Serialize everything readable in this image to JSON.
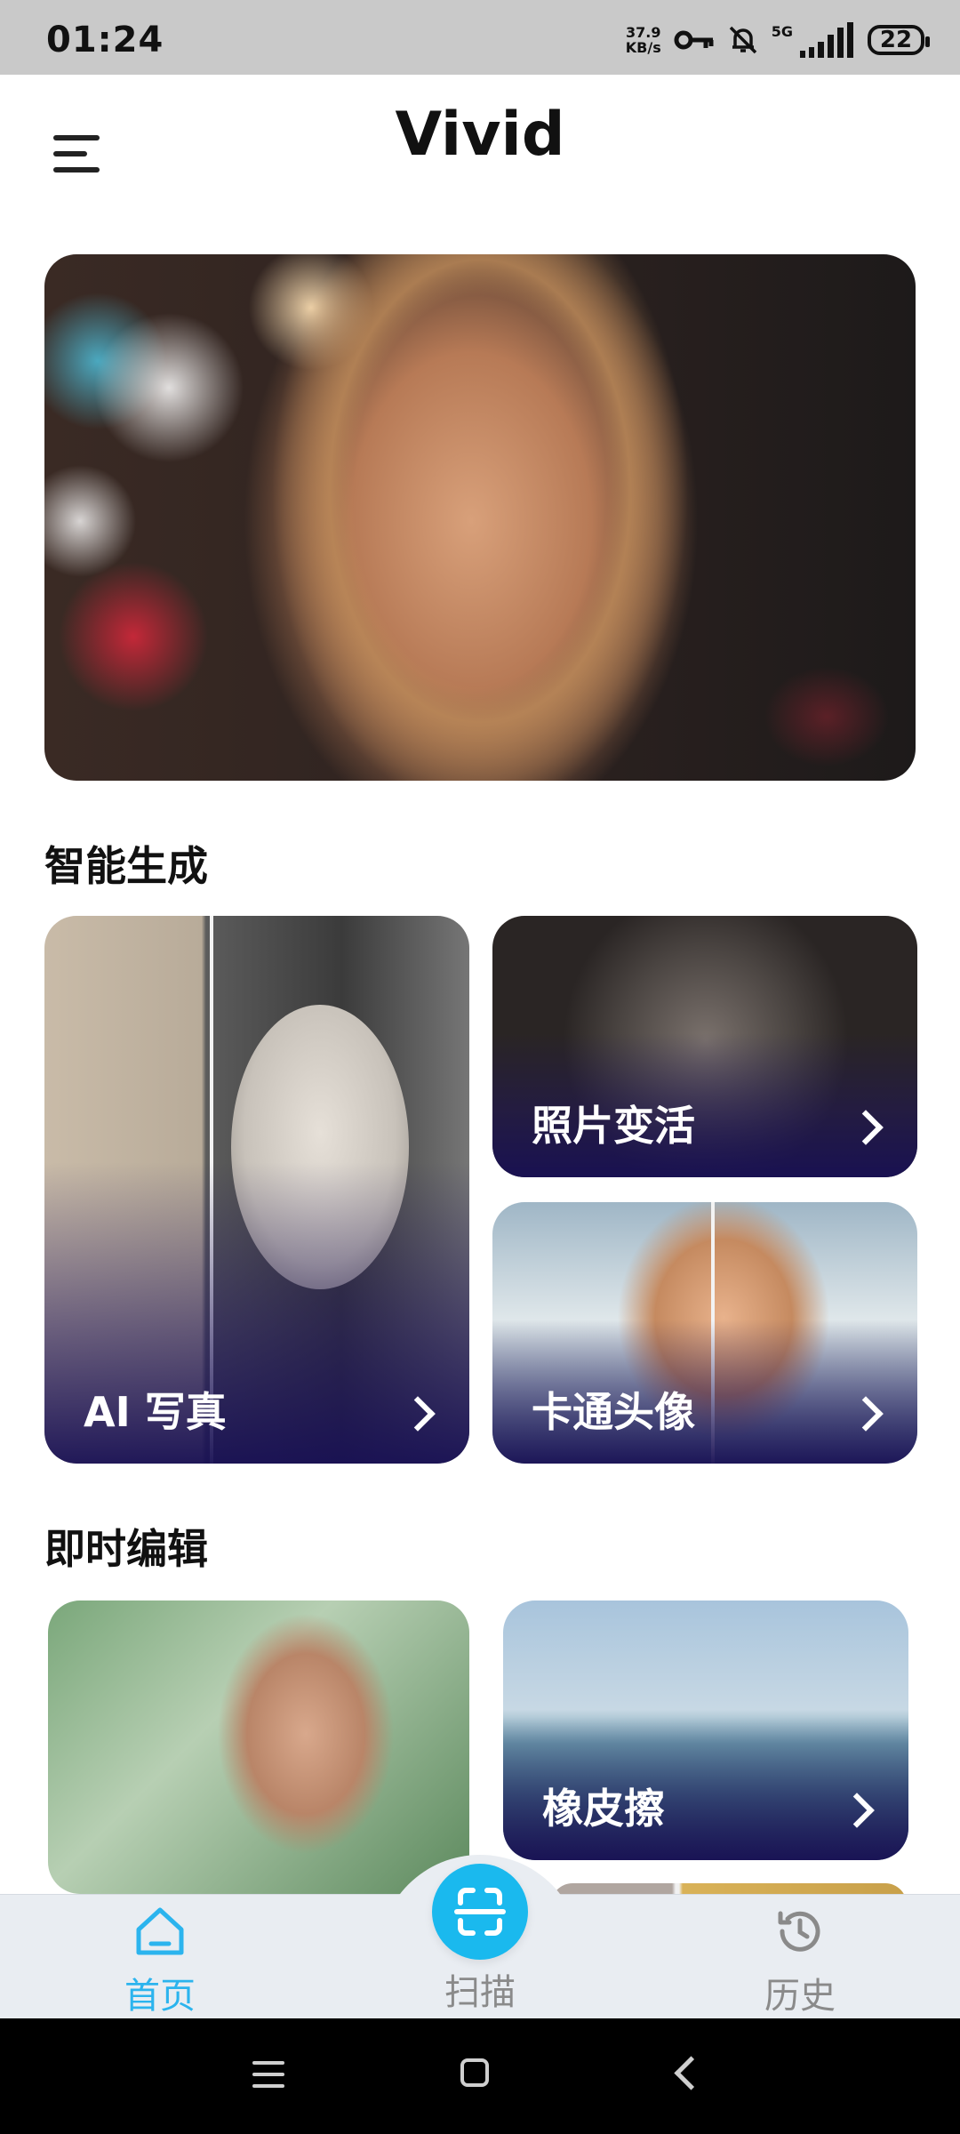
{
  "status_bar": {
    "time": "01:24",
    "net_speed_value": "37.9",
    "net_speed_unit": "KB/s",
    "network": "5G",
    "battery": "22"
  },
  "header": {
    "title": "Vivid"
  },
  "sections": {
    "smart_generate": {
      "title": "智能生成",
      "cards": [
        {
          "label": "AI 写真"
        },
        {
          "label": "照片变活"
        },
        {
          "label": "卡通头像"
        }
      ]
    },
    "instant_edit": {
      "title": "即时编辑",
      "cards": [
        {
          "label": "橡皮擦"
        }
      ]
    }
  },
  "bottom_nav": {
    "items": [
      {
        "label": "首页",
        "icon": "home-icon"
      },
      {
        "label": "扫描",
        "icon": "scan-icon"
      },
      {
        "label": "历史",
        "icon": "history-icon"
      }
    ],
    "active_color": "#2bb4ee",
    "inactive_color": "#8a8a8a",
    "scan_color": "#1ab9ee"
  }
}
